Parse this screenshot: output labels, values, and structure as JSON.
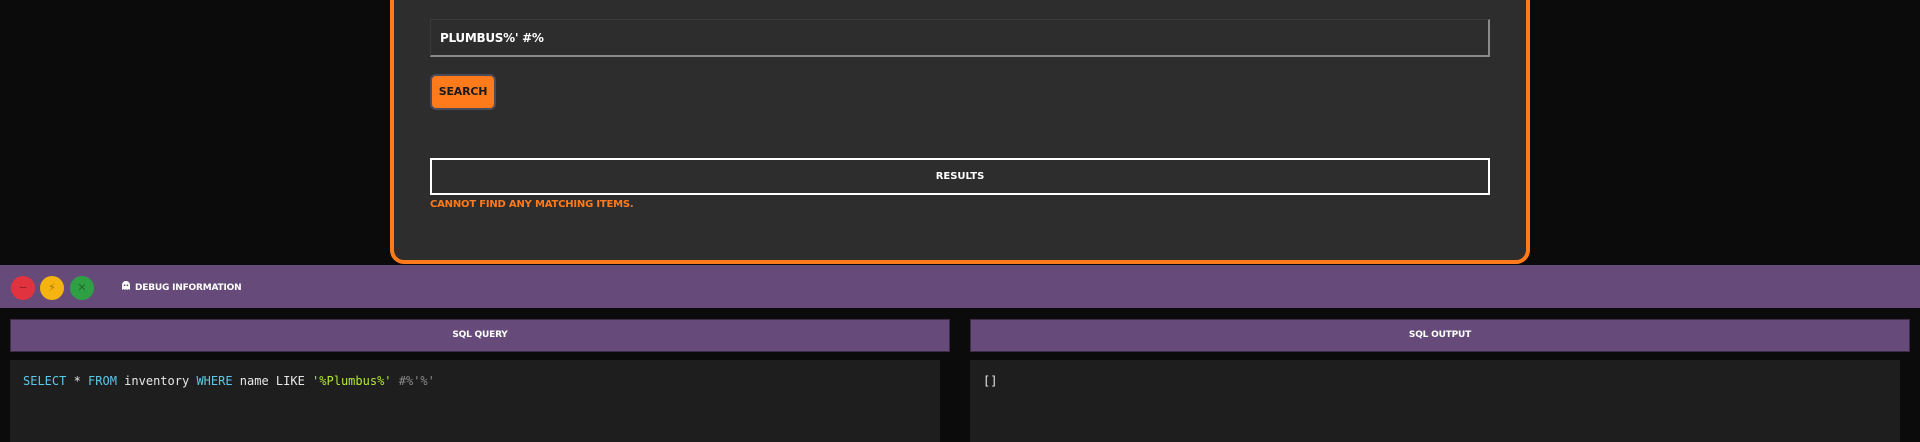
{
  "search": {
    "value": "PLUMBUS%' #%",
    "button_label": "SEARCH"
  },
  "results": {
    "header": "RESULTS",
    "empty_message": "CANNOT FIND ANY MATCHING ITEMS."
  },
  "debug": {
    "title": "DEBUG INFORMATION",
    "icon": "ghost-icon",
    "window_controls": [
      "close",
      "minimize",
      "maximize"
    ],
    "sql_query_header": "SQL QUERY",
    "sql_output_header": "SQL OUTPUT",
    "query": {
      "kw_select": "SELECT",
      "star": " * ",
      "kw_from": "FROM",
      "table": " inventory ",
      "kw_where": "WHERE",
      "rest": " name LIKE ",
      "string": "'%Plumbus%'",
      "comment": " #%'%'"
    },
    "output": "[]"
  },
  "colors": {
    "accent": "#ff7a1a",
    "debug_bar": "#664b7a",
    "close": "#e0333f",
    "minimize": "#f5b40f",
    "maximize": "#2ea043"
  }
}
